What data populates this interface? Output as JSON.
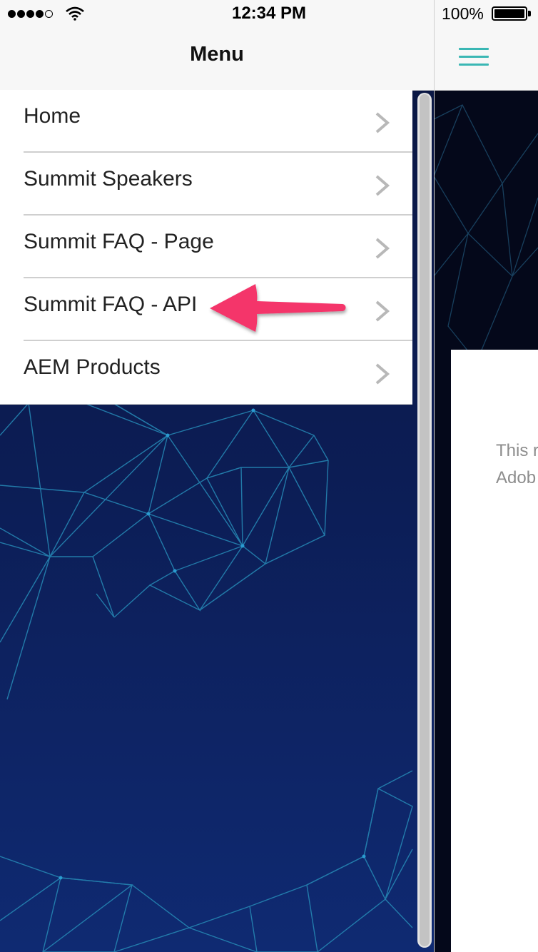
{
  "status_bar": {
    "time": "12:34 PM",
    "battery_percent": "100%",
    "signal_bars": 4,
    "signal_total": 5,
    "wifi_icon": "wifi-icon",
    "battery_icon": "battery-icon"
  },
  "nav": {
    "title": "Menu"
  },
  "menu": {
    "items": [
      {
        "label": "Home",
        "icon": "chevron-right-icon"
      },
      {
        "label": "Summit Speakers",
        "icon": "chevron-right-icon"
      },
      {
        "label": "Summit FAQ - Page",
        "icon": "chevron-right-icon"
      },
      {
        "label": "Summit FAQ - API",
        "icon": "chevron-right-icon"
      },
      {
        "label": "AEM Products",
        "icon": "chevron-right-icon"
      }
    ]
  },
  "right_panel": {
    "menu_icon": "hamburger-menu-icon",
    "content_line_1": "This r",
    "content_line_2": "Adob"
  },
  "annotation": {
    "icon": "pink-arrow-icon",
    "color": "#f4356b"
  },
  "colors": {
    "accent_teal": "#3ab7b4",
    "background_navy": "#0b1a4c",
    "polygon_lines": "#2a8fb8"
  }
}
